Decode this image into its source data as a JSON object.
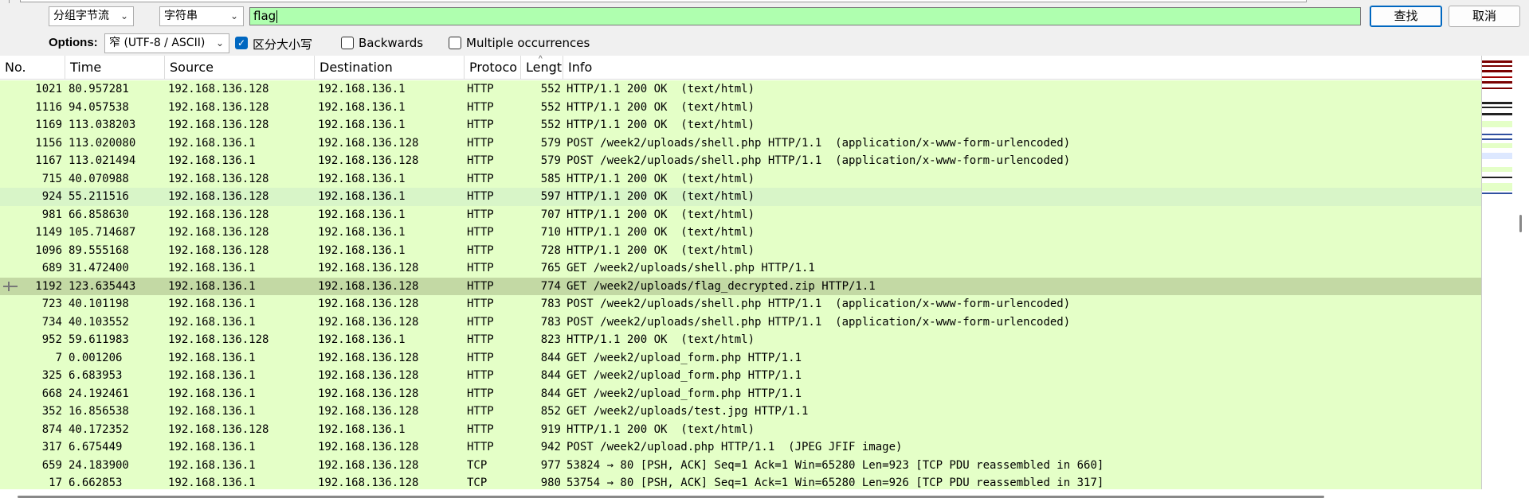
{
  "findbar": {
    "display_format": "分组字节流",
    "search_type": "字符串",
    "search_value": "flag",
    "find_label": "查找",
    "cancel_label": "取消"
  },
  "options": {
    "label": "Options:",
    "encoding": "窄 (UTF-8 / ASCII)",
    "case_sensitive_label": "区分大小写",
    "case_sensitive_checked": true,
    "backwards_label": "Backwards",
    "multiple_label": "Multiple occurrences"
  },
  "columns": {
    "no": "No.",
    "time": "Time",
    "source": "Source",
    "destination": "Destination",
    "protocol": "Protoco",
    "length": "Lengt",
    "info": "Info"
  },
  "packets": [
    {
      "no": "1021",
      "time": "80.957281",
      "src": "192.168.136.128",
      "dst": "192.168.136.1",
      "proto": "HTTP",
      "len": "552",
      "info": "HTTP/1.1 200 OK  (text/html)"
    },
    {
      "no": "1116",
      "time": "94.057538",
      "src": "192.168.136.128",
      "dst": "192.168.136.1",
      "proto": "HTTP",
      "len": "552",
      "info": "HTTP/1.1 200 OK  (text/html)"
    },
    {
      "no": "1169",
      "time": "113.038203",
      "src": "192.168.136.128",
      "dst": "192.168.136.1",
      "proto": "HTTP",
      "len": "552",
      "info": "HTTP/1.1 200 OK  (text/html)"
    },
    {
      "no": "1156",
      "time": "113.020080",
      "src": "192.168.136.1",
      "dst": "192.168.136.128",
      "proto": "HTTP",
      "len": "579",
      "info": "POST /week2/uploads/shell.php HTTP/1.1  (application/x-www-form-urlencoded)"
    },
    {
      "no": "1167",
      "time": "113.021494",
      "src": "192.168.136.1",
      "dst": "192.168.136.128",
      "proto": "HTTP",
      "len": "579",
      "info": "POST /week2/uploads/shell.php HTTP/1.1  (application/x-www-form-urlencoded)"
    },
    {
      "no": "715",
      "time": "40.070988",
      "src": "192.168.136.128",
      "dst": "192.168.136.1",
      "proto": "HTTP",
      "len": "585",
      "info": "HTTP/1.1 200 OK  (text/html)"
    },
    {
      "no": "924",
      "time": "55.211516",
      "src": "192.168.136.128",
      "dst": "192.168.136.1",
      "proto": "HTTP",
      "len": "597",
      "info": "HTTP/1.1 200 OK  (text/html)"
    },
    {
      "no": "981",
      "time": "66.858630",
      "src": "192.168.136.128",
      "dst": "192.168.136.1",
      "proto": "HTTP",
      "len": "707",
      "info": "HTTP/1.1 200 OK  (text/html)"
    },
    {
      "no": "1149",
      "time": "105.714687",
      "src": "192.168.136.128",
      "dst": "192.168.136.1",
      "proto": "HTTP",
      "len": "710",
      "info": "HTTP/1.1 200 OK  (text/html)"
    },
    {
      "no": "1096",
      "time": "89.555168",
      "src": "192.168.136.128",
      "dst": "192.168.136.1",
      "proto": "HTTP",
      "len": "728",
      "info": "HTTP/1.1 200 OK  (text/html)"
    },
    {
      "no": "689",
      "time": "31.472400",
      "src": "192.168.136.1",
      "dst": "192.168.136.128",
      "proto": "HTTP",
      "len": "765",
      "info": "GET /week2/uploads/shell.php HTTP/1.1"
    },
    {
      "no": "1192",
      "time": "123.635443",
      "src": "192.168.136.1",
      "dst": "192.168.136.128",
      "proto": "HTTP",
      "len": "774",
      "info": "GET /week2/uploads/flag_decrypted.zip HTTP/1.1"
    },
    {
      "no": "723",
      "time": "40.101198",
      "src": "192.168.136.1",
      "dst": "192.168.136.128",
      "proto": "HTTP",
      "len": "783",
      "info": "POST /week2/uploads/shell.php HTTP/1.1  (application/x-www-form-urlencoded)"
    },
    {
      "no": "734",
      "time": "40.103552",
      "src": "192.168.136.1",
      "dst": "192.168.136.128",
      "proto": "HTTP",
      "len": "783",
      "info": "POST /week2/uploads/shell.php HTTP/1.1  (application/x-www-form-urlencoded)"
    },
    {
      "no": "952",
      "time": "59.611983",
      "src": "192.168.136.128",
      "dst": "192.168.136.1",
      "proto": "HTTP",
      "len": "823",
      "info": "HTTP/1.1 200 OK  (text/html)"
    },
    {
      "no": "7",
      "time": "0.001206",
      "src": "192.168.136.1",
      "dst": "192.168.136.128",
      "proto": "HTTP",
      "len": "844",
      "info": "GET /week2/upload_form.php HTTP/1.1"
    },
    {
      "no": "325",
      "time": "6.683953",
      "src": "192.168.136.1",
      "dst": "192.168.136.128",
      "proto": "HTTP",
      "len": "844",
      "info": "GET /week2/upload_form.php HTTP/1.1"
    },
    {
      "no": "668",
      "time": "24.192461",
      "src": "192.168.136.1",
      "dst": "192.168.136.128",
      "proto": "HTTP",
      "len": "844",
      "info": "GET /week2/upload_form.php HTTP/1.1"
    },
    {
      "no": "352",
      "time": "16.856538",
      "src": "192.168.136.1",
      "dst": "192.168.136.128",
      "proto": "HTTP",
      "len": "852",
      "info": "GET /week2/uploads/test.jpg HTTP/1.1"
    },
    {
      "no": "874",
      "time": "40.172352",
      "src": "192.168.136.128",
      "dst": "192.168.136.1",
      "proto": "HTTP",
      "len": "919",
      "info": "HTTP/1.1 200 OK  (text/html)"
    },
    {
      "no": "317",
      "time": "6.675449",
      "src": "192.168.136.1",
      "dst": "192.168.136.128",
      "proto": "HTTP",
      "len": "942",
      "info": "POST /week2/upload.php HTTP/1.1  (JPEG JFIF image)"
    },
    {
      "no": "659",
      "time": "24.183900",
      "src": "192.168.136.1",
      "dst": "192.168.136.128",
      "proto": "TCP",
      "len": "977",
      "info": "53824 → 80 [PSH, ACK] Seq=1 Ack=1 Win=65280 Len=923 [TCP PDU reassembled in 660]"
    },
    {
      "no": "17",
      "time": "6.662853",
      "src": "192.168.136.1",
      "dst": "192.168.136.128",
      "proto": "TCP",
      "len": "980",
      "info": "53754 → 80 [PSH, ACK] Seq=1 Ack=1 Win=65280 Len=926 [TCP PDU reassembled in 317]"
    }
  ],
  "row_states": {
    "hover_row": 6,
    "selected_row": 11
  },
  "colors": {
    "row_bg": "#e4ffc7",
    "row_hover": "#d8f5c8",
    "row_selected": "#c3d9a4",
    "search_bg": "#afffaf",
    "accent": "#0067c0"
  }
}
